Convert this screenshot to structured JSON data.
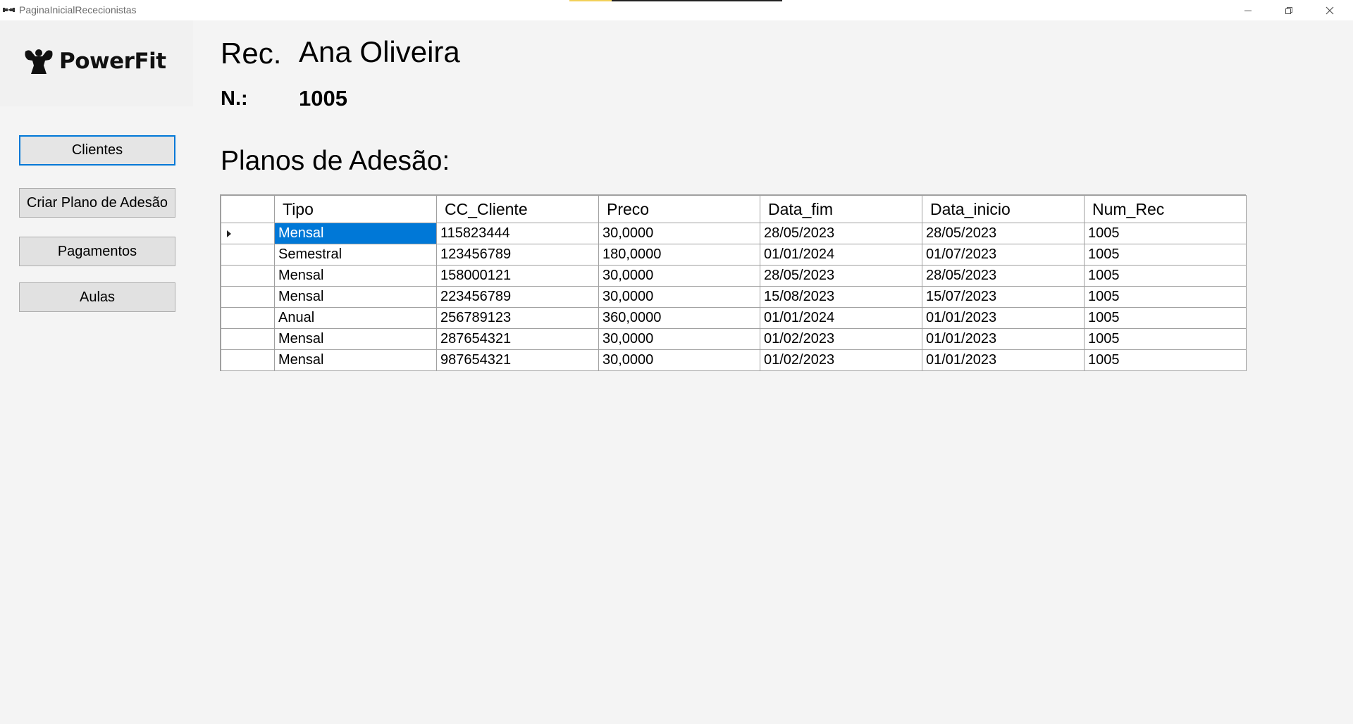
{
  "window": {
    "title": "PaginaInicialRececionistas",
    "icons": [
      "app-icon",
      "minimize-icon",
      "restore-icon",
      "close-icon"
    ]
  },
  "logo": {
    "text": "PowerFit",
    "icon": "muscle-icon"
  },
  "sidebar": {
    "buttons": [
      {
        "label": "Clientes"
      },
      {
        "label": "Criar Plano de Adesão"
      },
      {
        "label": "Pagamentos"
      },
      {
        "label": "Aulas"
      }
    ]
  },
  "header": {
    "rec_label": "Rec.",
    "rec_name": "Ana Oliveira",
    "num_label": "N.:",
    "num_value": "1005",
    "section_title": "Planos de Adesão:"
  },
  "colors": {
    "accent": "#0078d7",
    "background": "#f4f4f4",
    "button": "#e1e1e1"
  },
  "grid": {
    "columns": [
      "Tipo",
      "CC_Cliente",
      "Preco",
      "Data_fim",
      "Data_inicio",
      "Num_Rec"
    ],
    "selected_row": 0,
    "rows": [
      [
        "Mensal",
        "115823444",
        "30,0000",
        "28/05/2023",
        "28/05/2023",
        "1005"
      ],
      [
        "Semestral",
        "123456789",
        "180,0000",
        "01/01/2024",
        "01/07/2023",
        "1005"
      ],
      [
        "Mensal",
        "158000121",
        "30,0000",
        "28/05/2023",
        "28/05/2023",
        "1005"
      ],
      [
        "Mensal",
        "223456789",
        "30,0000",
        "15/08/2023",
        "15/07/2023",
        "1005"
      ],
      [
        "Anual",
        "256789123",
        "360,0000",
        "01/01/2024",
        "01/01/2023",
        "1005"
      ],
      [
        "Mensal",
        "287654321",
        "30,0000",
        "01/02/2023",
        "01/01/2023",
        "1005"
      ],
      [
        "Mensal",
        "987654321",
        "30,0000",
        "01/02/2023",
        "01/01/2023",
        "1005"
      ]
    ]
  }
}
